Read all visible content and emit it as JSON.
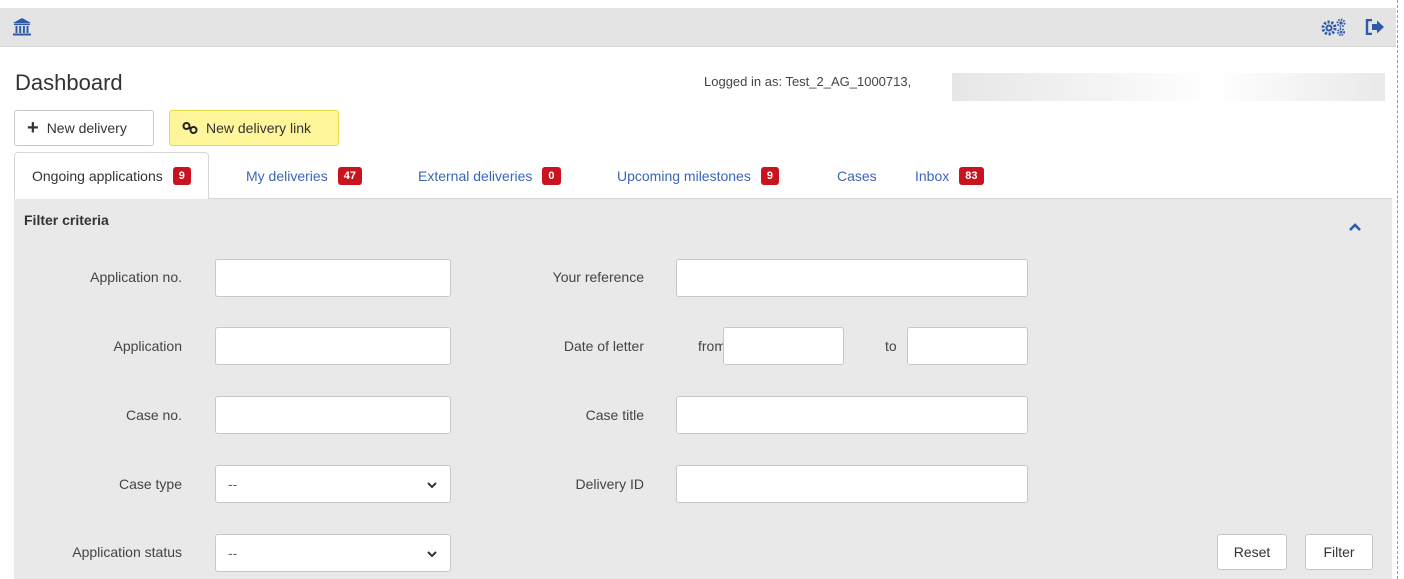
{
  "header": {
    "home_icon": "bank-icon",
    "settings_icon": "gears-icon",
    "logout_icon": "sign-out-icon"
  },
  "page": {
    "title": "Dashboard",
    "logged_in_label": "Logged in as: Test_2_AG_1000713,"
  },
  "actions": {
    "new_delivery": "New delivery",
    "new_delivery_link": "New delivery link",
    "highlight_color": "#fff59a"
  },
  "tabs": [
    {
      "label": "Ongoing applications",
      "count": "9",
      "active": true
    },
    {
      "label": "My deliveries",
      "count": "47",
      "active": false
    },
    {
      "label": "External deliveries",
      "count": "0",
      "active": false
    },
    {
      "label": "Upcoming milestones",
      "count": "9",
      "active": false
    },
    {
      "label": "Cases",
      "count": "",
      "active": false
    },
    {
      "label": "Inbox",
      "count": "83",
      "active": false
    }
  ],
  "filter": {
    "title": "Filter criteria",
    "application_no": {
      "label": "Application no.",
      "value": ""
    },
    "application": {
      "label": "Application",
      "value": ""
    },
    "case_no": {
      "label": "Case no.",
      "value": ""
    },
    "case_type": {
      "label": "Case type",
      "selected": "--"
    },
    "application_status": {
      "label": "Application status",
      "selected": "--"
    },
    "your_reference": {
      "label": "Your reference",
      "value": ""
    },
    "date_of_letter": {
      "label": "Date of letter",
      "from_label": "from",
      "to_label": "to",
      "from_value": "",
      "to_value": ""
    },
    "case_title": {
      "label": "Case title",
      "value": ""
    },
    "delivery_id": {
      "label": "Delivery ID",
      "value": ""
    },
    "reset": "Reset",
    "filter": "Filter"
  },
  "colors": {
    "link_blue": "#3b66b8",
    "badge_red": "#c9141f",
    "panel_bg": "#e9e9e9"
  }
}
